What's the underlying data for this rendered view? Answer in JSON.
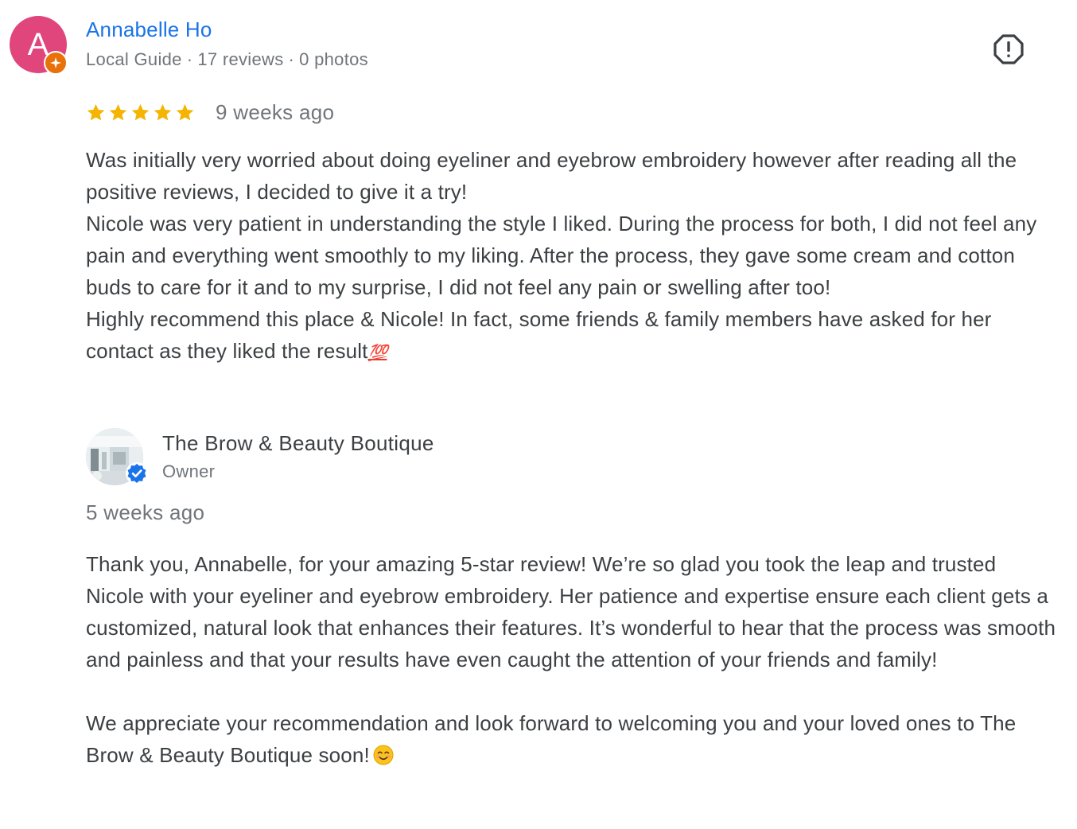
{
  "reviewer": {
    "initial": "A",
    "name": "Annabelle Ho",
    "level": "Local Guide",
    "reviews": "17 reviews",
    "photos": "0 photos",
    "avatar_color": "#e0457b"
  },
  "review": {
    "rating": 5,
    "time": "9 weeks ago",
    "paragraphs": [
      "Was initially very worried about doing eyeliner and eyebrow embroidery however after reading all the positive reviews, I decided to give it a try!",
      "Nicole was very patient in understanding the style I liked. During the process for both, I did not feel any pain and everything went smoothly to my liking. After the process, they gave some cream and cotton buds to care for it and to my surprise, I did not feel any pain or swelling after too!",
      "Highly recommend this place & Nicole! In fact, some friends & family members have asked for her contact as they liked the result"
    ],
    "emoji": "💯"
  },
  "reply": {
    "owner_name": "The Brow & Beauty Boutique",
    "owner_role": "Owner",
    "time": "5 weeks ago",
    "paragraphs": [
      "Thank you, Annabelle, for your amazing 5-star review! We’re so glad you took the leap and trusted Nicole with your eyeliner and eyebrow embroidery. Her patience and expertise ensure each client gets a customized, natural look that enhances their features. It’s wonderful to hear that the process was smooth and painless and that your results have even caught the attention of your friends and family!",
      "We appreciate your recommendation and look forward to welcoming you and your loved ones to The Brow & Beauty Boutique soon!"
    ]
  },
  "icons": {
    "report": "report-icon",
    "guide_badge": "local-guide-badge-icon",
    "verified": "verified-badge-icon",
    "star": "star-icon",
    "smile": "smiling-face-emoji-icon"
  },
  "colors": {
    "link": "#1a73e8",
    "star": "#f4b400",
    "muted": "#70757a",
    "text": "#3c4043",
    "guide_badge": "#e8710a",
    "verified": "#1a73e8"
  }
}
